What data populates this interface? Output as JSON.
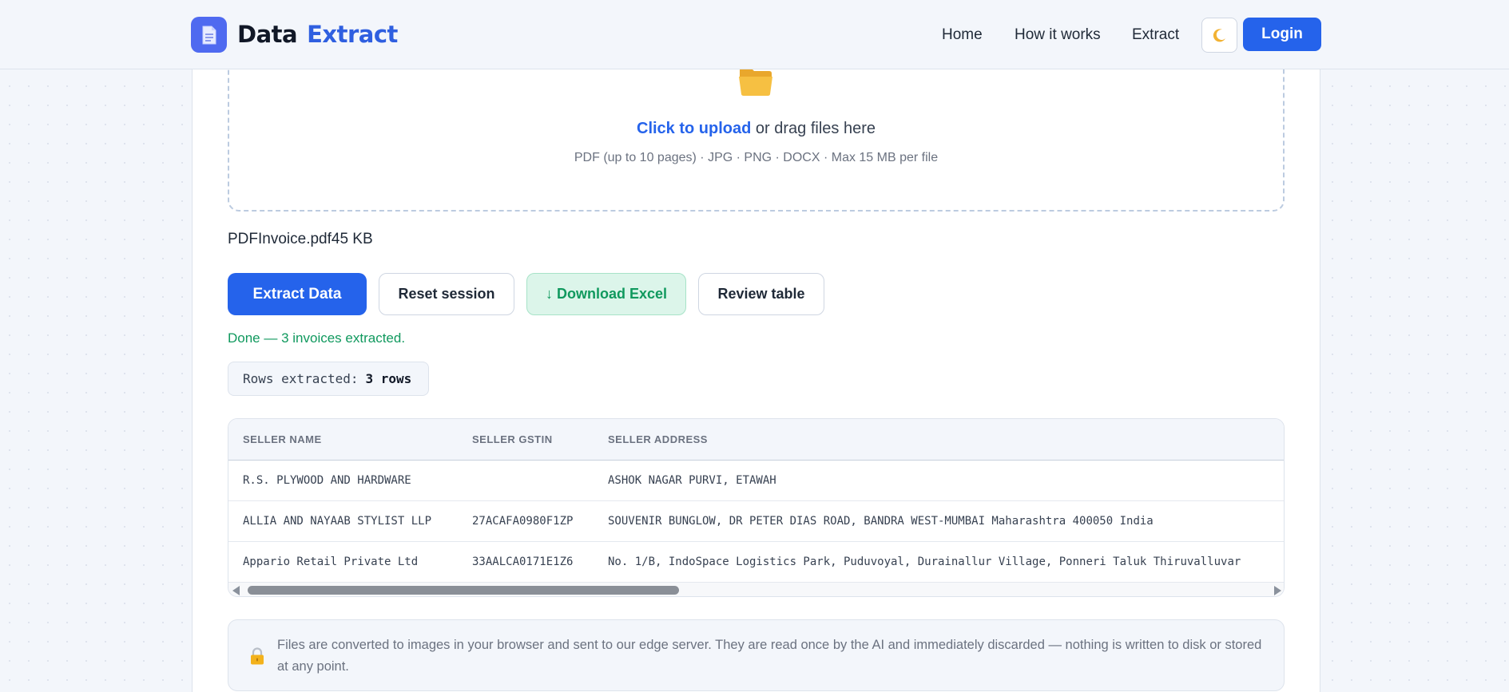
{
  "header": {
    "brand_word1": "Data",
    "brand_word2": "Extract",
    "nav": [
      "Home",
      "How it works",
      "Extract"
    ],
    "theme_toggle_icon": "moon-icon",
    "login_label": "Login"
  },
  "upload": {
    "link_text": "Click to upload",
    "rest_text": " or drag files here",
    "hint": "PDF (up to 10 pages) · JPG · PNG · DOCX · Max 15 MB per file",
    "icon": "folder-icon"
  },
  "file": {
    "name": "PDFInvoice.pdf45 KB"
  },
  "actions": {
    "extract_label": "Extract Data",
    "reset_label": "Reset session",
    "download_label": "↓ Download Excel",
    "review_label": "Review table"
  },
  "status": {
    "text": "Done — 3 invoices extracted."
  },
  "rows_badge": {
    "label": "Rows extracted:",
    "value": "3 rows"
  },
  "table": {
    "columns": [
      "Seller Name",
      "Seller GSTIN",
      "Seller Address"
    ],
    "rows": [
      [
        "R.S. PLYWOOD AND HARDWARE",
        "",
        "ASHOK NAGAR PURVI, ETAWAH"
      ],
      [
        "ALLIA AND NAYAAB STYLIST LLP",
        "27ACAFA0980F1ZP",
        "SOUVENIR BUNGLOW, DR PETER DIAS ROAD, BANDRA WEST-MUMBAI Maharashtra 400050 India"
      ],
      [
        "Appario Retail Private Ltd",
        "33AALCA0171E1Z6",
        "No. 1/B, IndoSpace Logistics Park, Puduvoyal, Durainallur Village, Ponneri Taluk Thiruvalluvar"
      ]
    ]
  },
  "privacy": {
    "icon": "lock-icon",
    "text": "Files are converted to images in your browser and sent to our edge server. They are read once by the AI and immediately discarded — nothing is written to disk or stored at any point."
  },
  "colors": {
    "primary": "#2563eb",
    "success": "#10995e",
    "background": "#f3f6fb"
  }
}
